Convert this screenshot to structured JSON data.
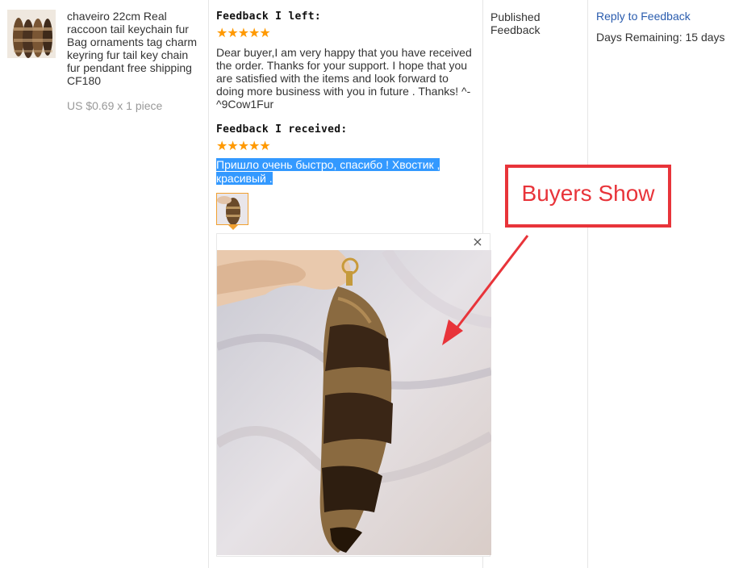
{
  "product": {
    "title": "chaveiro 22cm Real raccoon tail keychain fur Bag ornaments tag charm keyring fur tail key chain fur pendant free shipping CF180",
    "price": "US $0.69 x 1 piece"
  },
  "feedback_left": {
    "heading": "Feedback I left:",
    "rating": 5,
    "stars": "★★★★★",
    "text": "Dear buyer,I am very happy that you have received the order. Thanks for your support. I hope that you are satisfied with the items and look forward to doing more business with you in future . Thanks! ^-^9Cow1Fur"
  },
  "feedback_received": {
    "heading": "Feedback I received:",
    "rating": 5,
    "stars": "★★★★★",
    "text": "Пришло очень быстро, спасибо ! Хвостик , красивый ."
  },
  "viewer": {
    "close_glyph": "×"
  },
  "status": {
    "label": "Published Feedback"
  },
  "actions": {
    "reply_link": "Reply to Feedback",
    "days_remaining": "Days Remaining: 15 days"
  },
  "annotation": {
    "label": "Buyers Show",
    "color": "#e8343a"
  },
  "colors": {
    "star": "#ff9900",
    "link": "#2a5cae",
    "selection": "#3399ff",
    "muted": "#999999"
  }
}
